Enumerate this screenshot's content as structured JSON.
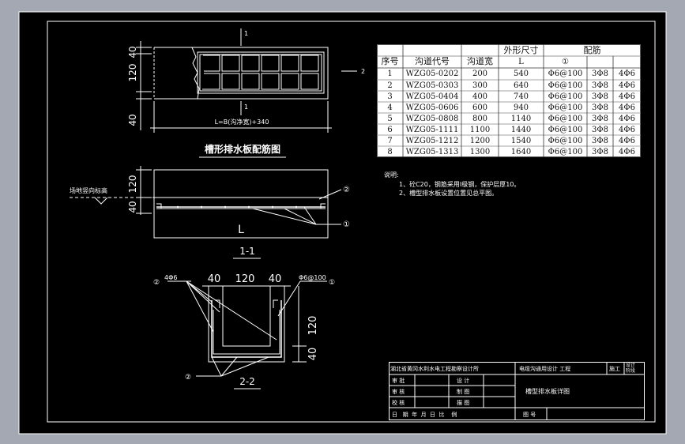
{
  "plan_view": {
    "dims_vertical": [
      "40",
      "120",
      "40"
    ],
    "section_marker": "1",
    "section_side": "2",
    "length_formula": "L=B(沟净宽)+340"
  },
  "plan_title": "槽形排水板配筋图",
  "section_1": {
    "ground_label": "场地竖向标高",
    "dims_vertical": [
      "120",
      "40"
    ],
    "length_label": "L",
    "callout_2": "②",
    "callout_1": "①",
    "title": "1-1"
  },
  "section_2": {
    "rebar_label": "4Φ6",
    "stirrup_label": "Φ6@100",
    "dims_top": [
      "40",
      "120",
      "40"
    ],
    "dims_right": [
      "120",
      "40"
    ],
    "callout_2_left": "②",
    "callout_1_right": "①",
    "callout_2_bottom": "②",
    "title": "2-2"
  },
  "table": {
    "headers": {
      "seq": "序号",
      "code": "沟道代号",
      "width": "沟道宽",
      "outer": "外形尺寸",
      "outer_sub": "L",
      "rebar": "配筋",
      "rebar_sub1": "①"
    },
    "rows": [
      [
        "1",
        "WZG05-0202",
        "200",
        "540",
        "Φ6@100",
        "3Φ8",
        "4Φ6"
      ],
      [
        "2",
        "WZG05-0303",
        "300",
        "640",
        "Φ6@100",
        "3Φ8",
        "4Φ6"
      ],
      [
        "3",
        "WZG05-0404",
        "400",
        "740",
        "Φ6@100",
        "3Φ8",
        "4Φ6"
      ],
      [
        "4",
        "WZG05-0606",
        "600",
        "940",
        "Φ6@100",
        "3Φ8",
        "4Φ6"
      ],
      [
        "5",
        "WZG05-0808",
        "800",
        "1140",
        "Φ6@100",
        "3Φ8",
        "4Φ6"
      ],
      [
        "6",
        "WZG05-1111",
        "1100",
        "1440",
        "Φ6@100",
        "3Φ8",
        "4Φ6"
      ],
      [
        "7",
        "WZG05-1212",
        "1200",
        "1540",
        "Φ6@100",
        "3Φ8",
        "4Φ6"
      ],
      [
        "8",
        "WZG05-1313",
        "1300",
        "1640",
        "Φ6@100",
        "3Φ8",
        "4Φ6"
      ]
    ]
  },
  "notes": {
    "heading": "说明:",
    "items": [
      "1、砼C20，钢筋采用I级钢，保护层厚10。",
      "2、槽型排水板设置位置见总平图。"
    ]
  },
  "title_block": {
    "institute": "湖北省黄冈水利水电工程勘察设计所",
    "project": "电缆沟通用设计  工程",
    "stage": "施工",
    "stage2": "设计\n阶段",
    "row_labels_left": [
      "审 批",
      "审 核",
      "校 核"
    ],
    "row_labels_mid": [
      "设 计",
      "制 图",
      "描 图"
    ],
    "bottom_row": "日   期  年  月  日  比    例",
    "drawing_name": "槽型排水板详图",
    "drawing_no_label": "图 号"
  },
  "colors": {
    "background": "#000000",
    "line": "#ffffff",
    "table_bg": "#ffffff",
    "window_bg": "#a3a8b2"
  }
}
